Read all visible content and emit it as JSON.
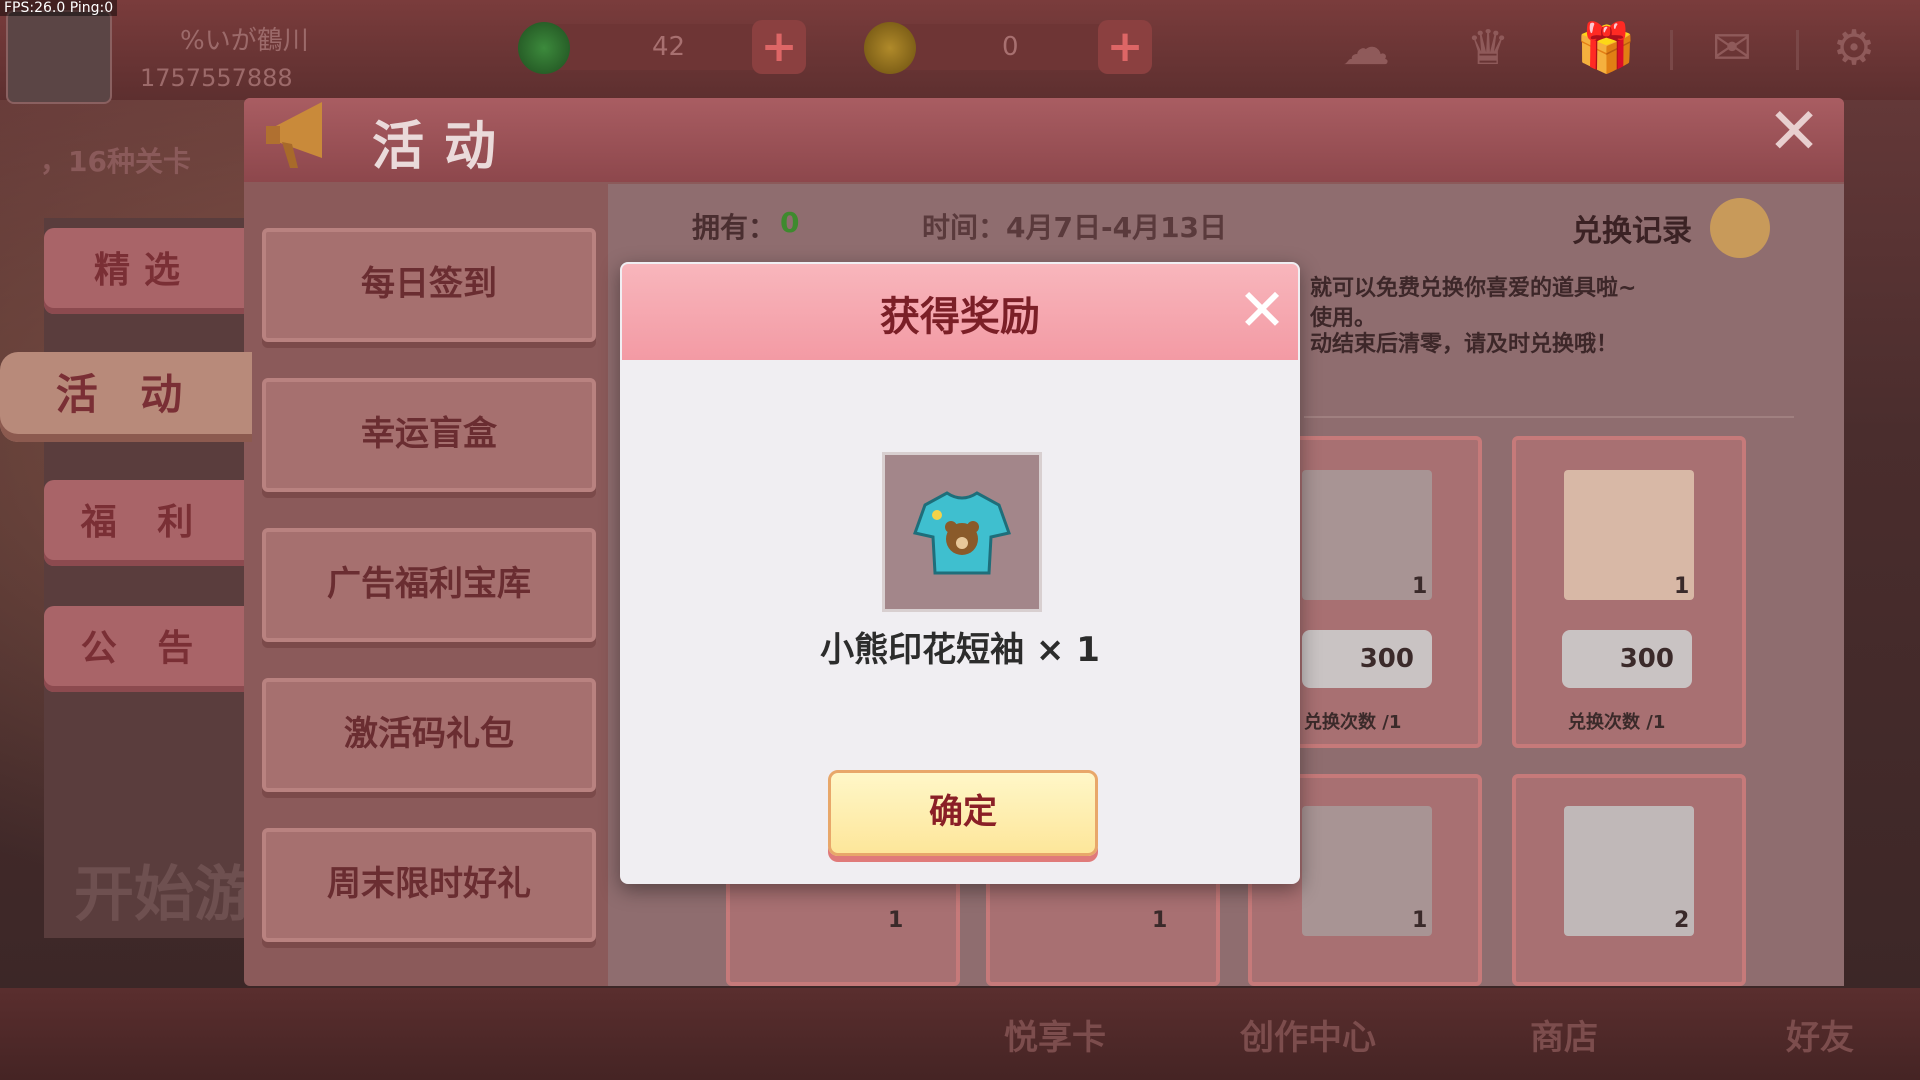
{
  "hud": {
    "fps": "FPS:26.0  Ping:0",
    "player_name": "%いが鶴川",
    "player_id": "1757557888",
    "currency1_value": "42",
    "currency2_value": "0"
  },
  "bottom_nav": [
    "悦享卡",
    "创作中心",
    "商店",
    "好友"
  ],
  "background": {
    "level_text": "，16种关卡",
    "start_text": "开始游"
  },
  "activity_panel": {
    "title": "活动",
    "tabs": [
      "精选",
      "活 动",
      "福 利",
      "公 告"
    ],
    "active_tab_index": 1,
    "menu": [
      "每日签到",
      "幸运盲盒",
      "广告福利宝库",
      "激活码礼包",
      "周末限时好礼"
    ],
    "own_label": "拥有：",
    "own_value": "0",
    "time_label": "时间：4月7日-4月13日",
    "record_label": "兑换记录",
    "desc_lines": [
      "就可以免费兑换你喜爱的道具啦~",
      "使用。",
      "动结束后清零，请及时兑换哦！"
    ],
    "cards": [
      {
        "qty": "1",
        "price": "300",
        "exchange": "兑换次数  /1"
      },
      {
        "qty": "1",
        "price": "300",
        "exchange": "兑换次数  /1"
      },
      {
        "qty": "1"
      },
      {
        "qty": "2"
      },
      {
        "qty": "1"
      },
      {
        "qty": "1"
      }
    ]
  },
  "reward_dialog": {
    "title": "获得奖励",
    "item_name": "小熊印花短袖 × 1",
    "confirm_label": "确定"
  },
  "colors": {
    "accent_pink": "#f39aa4",
    "confirm_bg": "#fde69a",
    "own_value_green": "#3e8a2e"
  },
  "icons": [
    "megaphone-icon",
    "close-icon",
    "record-list-icon",
    "coin-icon",
    "gift-icon",
    "mail-icon",
    "gear-icon",
    "crown-icon",
    "plus-icon",
    "tshirt-icon"
  ]
}
